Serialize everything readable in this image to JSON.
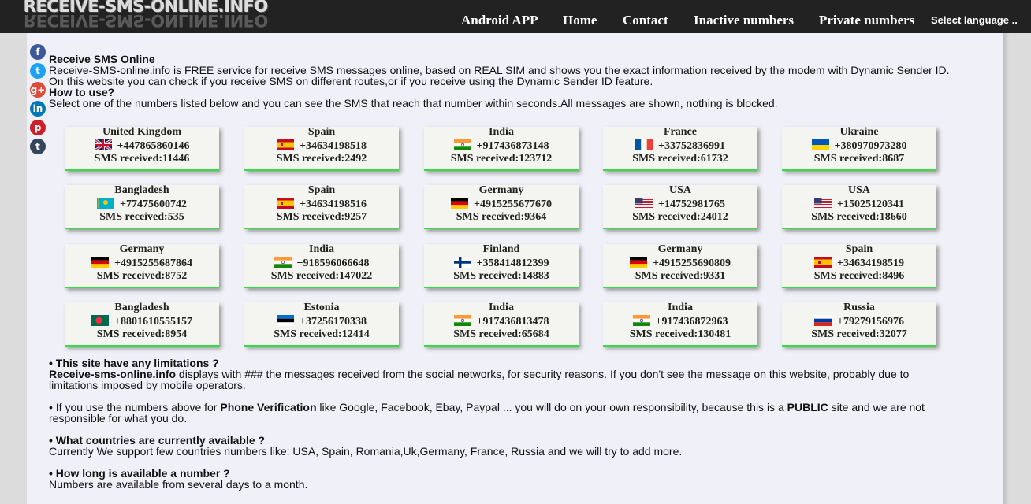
{
  "header": {
    "logo": "RECEIVE-SMS-ONLINE.INFO",
    "nav": [
      "Android APP",
      "Home",
      "Contact",
      "Inactive numbers",
      "Private numbers"
    ],
    "language": "Select language .."
  },
  "social": [
    {
      "icon": "facebook-icon",
      "glyph": "f",
      "color": "#3b5998"
    },
    {
      "icon": "twitter-icon",
      "glyph": "t",
      "color": "#1da1f2"
    },
    {
      "icon": "google-plus-icon",
      "glyph": "g+",
      "color": "#dd4b39"
    },
    {
      "icon": "linkedin-icon",
      "glyph": "in",
      "color": "#0077b5"
    },
    {
      "icon": "pinterest-icon",
      "glyph": "p",
      "color": "#cb2027"
    },
    {
      "icon": "tumblr-icon",
      "glyph": "t",
      "color": "#35465c"
    }
  ],
  "intro": {
    "title": "Receive SMS Online",
    "line1": "Receive-SMS-online.info is FREE service for receive SMS messages online, based on REAL SIM and shows you the exact information received by the modem with Dynamic Sender ID.",
    "line2": "On this website you can check if you receive SMS on different routes,or if you receive using the Dynamic Sender ID feature.",
    "howto_title": "How to use?",
    "howto_text": "Select one of the numbers listed below and you can see the SMS that reach that number within seconds.All messages are shown, nothing is blocked."
  },
  "sms_prefix": "SMS received:",
  "numbers": [
    {
      "country": "United Kingdom",
      "flag": "uk",
      "number": "+447865860146",
      "sms": "11446"
    },
    {
      "country": "Spain",
      "flag": "es",
      "number": "+34634198518",
      "sms": "2492"
    },
    {
      "country": "India",
      "flag": "in",
      "number": "+917436873148",
      "sms": "123712"
    },
    {
      "country": "France",
      "flag": "fr",
      "number": "+33752836991",
      "sms": "61732"
    },
    {
      "country": "Ukraine",
      "flag": "ua",
      "number": "+380970973280",
      "sms": "8687"
    },
    {
      "country": "Bangladesh",
      "flag": "kz",
      "number": "+77475600742",
      "sms": "535"
    },
    {
      "country": "Spain",
      "flag": "es",
      "number": "+34634198516",
      "sms": "9257"
    },
    {
      "country": "Germany",
      "flag": "de",
      "number": "+4915255677670",
      "sms": "9364"
    },
    {
      "country": "USA",
      "flag": "us",
      "number": "+14752981765",
      "sms": "24012"
    },
    {
      "country": "USA",
      "flag": "us",
      "number": "+15025120341",
      "sms": "18660"
    },
    {
      "country": "Germany",
      "flag": "de",
      "number": "+4915255687864",
      "sms": "8752"
    },
    {
      "country": "India",
      "flag": "in",
      "number": "+918596066648",
      "sms": "147022"
    },
    {
      "country": "Finland",
      "flag": "fi",
      "number": "+358414812399",
      "sms": "14883"
    },
    {
      "country": "Germany",
      "flag": "de",
      "number": "+4915255690809",
      "sms": "9331"
    },
    {
      "country": "Spain",
      "flag": "es",
      "number": "+34634198519",
      "sms": "8496"
    },
    {
      "country": "Bangladesh",
      "flag": "bd",
      "number": "+8801610555157",
      "sms": "8954"
    },
    {
      "country": "Estonia",
      "flag": "ee",
      "number": "+37256170338",
      "sms": "12414"
    },
    {
      "country": "India",
      "flag": "in",
      "number": "+917436813478",
      "sms": "65684"
    },
    {
      "country": "India",
      "flag": "in",
      "number": "+917436872963",
      "sms": "130481"
    },
    {
      "country": "Russia",
      "flag": "ru",
      "number": "+79279156976",
      "sms": "32077"
    }
  ],
  "faq": {
    "q1": "• This site have any limitations ?",
    "a1_bold": "Receive-sms-online.info",
    "a1_rest": " displays with ### the messages received from the social networks, for security reasons. If you don't see the message on this website, probably due to",
    "a1_line2": "limitations imposed by mobile operators.",
    "p2_a": "• If you use the numbers above for ",
    "p2_bold1": "Phone Verification",
    "p2_b": " like Google, Facebook, Ebay, Paypal ... you will do on your own responsibility, because this is a ",
    "p2_bold2": "PUBLIC",
    "p2_c": " site and we are not",
    "p2_line2": "responsible for what you do.",
    "q3": "• What countries are currently available ?",
    "a3": "Currently We support few countries numbers like: USA, Spain, Romania,Uk,Germany, France, Russia and we will try to add more.",
    "q4": "• How long is available a number ?",
    "a4": "Numbers are available from several days to a month."
  }
}
